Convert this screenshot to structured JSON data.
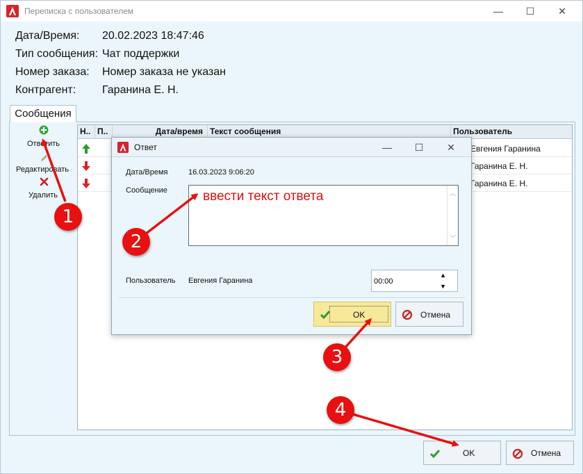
{
  "window": {
    "title": "Переписка с пользователем",
    "controls": {
      "minimize": "—",
      "maximize": "☐",
      "close": "✕"
    }
  },
  "info": [
    {
      "label": "Дата/Время:",
      "value": "20.02.2023 18:47:46"
    },
    {
      "label": "Тип сообщения:",
      "value": "Чат поддержки"
    },
    {
      "label": "Номер заказа:",
      "value": "Номер заказа не указан"
    },
    {
      "label": "Контрагент:",
      "value": "Гаранина Е. Н."
    }
  ],
  "tab": {
    "label": "Сообщения"
  },
  "toolbar": {
    "reply": "Ответить",
    "edit": "Редактировать",
    "delete": "Удалить"
  },
  "grid": {
    "columns": [
      "Н..",
      "П..",
      "Дата/время",
      "Текст сообщения",
      "Пользователь"
    ],
    "rows": [
      {
        "direction": "up",
        "user": "Евгения Гаранина"
      },
      {
        "direction": "down",
        "user": "Гаранина Е. Н."
      },
      {
        "direction": "down",
        "user": "Гаранина Е. Н."
      }
    ]
  },
  "dialog": {
    "title": "Ответ",
    "datetime_label": "Дата/Время",
    "datetime_value": "16.03.2023 9:06:20",
    "message_label": "Сообщение",
    "user_label": "Пользователь",
    "user_value": "Евгения Гаранина",
    "time_value": "00:00",
    "ok": "OK",
    "cancel": "Отмена"
  },
  "buttons": {
    "ok": "OK",
    "cancel": "Отмена"
  },
  "annotation": {
    "text": "ввести текст ответа",
    "badges": [
      "1",
      "2",
      "3",
      "4"
    ]
  },
  "colors": {
    "accent_red": "#e81010",
    "window_bg": "#eaf6fb",
    "ok_highlight": "#f7e99a",
    "arrow_up": "#2e9a2e",
    "arrow_down": "#e02020"
  }
}
